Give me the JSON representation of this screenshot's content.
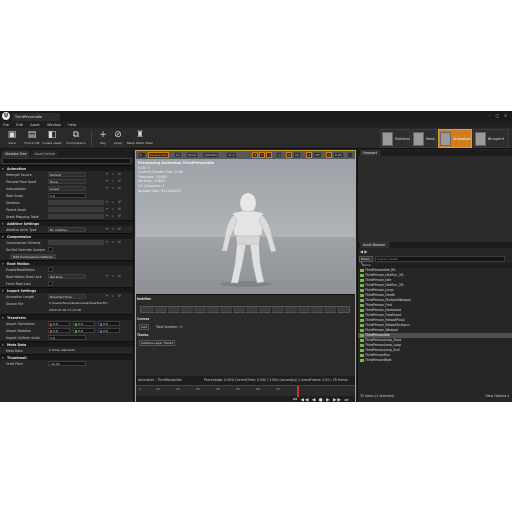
{
  "window": {
    "tab_title": "ThirdPersonIdle",
    "app_logo": "U"
  },
  "menu": [
    "File",
    "Edit",
    "Asset",
    "Window",
    "Help"
  ],
  "toolbar": {
    "buttons": [
      {
        "label": "Save",
        "icon": "save-icon"
      },
      {
        "label": "Find in CB",
        "icon": "find-in-cb-icon"
      },
      {
        "label": "Create Asset",
        "icon": "create-asset-icon"
      },
      {
        "label": "Compression",
        "icon": "compression-icon"
      },
      {
        "label": "Key",
        "icon": "key-icon"
      },
      {
        "label": "Apply",
        "icon": "apply-icon"
      },
      {
        "label": "Make Static Mesh",
        "icon": "static-mesh-icon"
      }
    ],
    "modes": [
      {
        "label": "Skeleton",
        "active": false
      },
      {
        "label": "Mesh",
        "active": false
      },
      {
        "label": "Animation",
        "active": true
      },
      {
        "label": "Blueprint",
        "active": false
      }
    ]
  },
  "left_panel": {
    "tabs": [
      "Skeleton Tree",
      "Asset Details"
    ],
    "sections": [
      {
        "title": "Animation",
        "rows": [
          {
            "key": "Retarget Source",
            "value": "Default",
            "type": "dd"
          },
          {
            "key": "Preview Pose Asset",
            "value": "None",
            "type": "dd"
          },
          {
            "key": "Interpolation",
            "value": "Linear",
            "type": "dd"
          },
          {
            "key": "Rate Scale",
            "value": "1.0",
            "type": "num"
          },
          {
            "key": "Skeleton",
            "value": "",
            "type": "wide"
          },
          {
            "key": "Parent Asset",
            "value": "",
            "type": "wide"
          },
          {
            "key": "Asset Mapping Table",
            "value": "",
            "type": "wide"
          }
        ]
      },
      {
        "title": "Additive Settings",
        "rows": [
          {
            "key": "Additive Anim Type",
            "value": "No additive",
            "type": "dd"
          }
        ]
      },
      {
        "title": "Compression",
        "rows": [
          {
            "key": "Compression Scheme",
            "value": "",
            "type": "wide"
          },
          {
            "key": "Do Not Override Compre",
            "value": "",
            "type": "cb"
          },
          {
            "key": "",
            "value": "Edit Compression Settings",
            "type": "btn"
          }
        ]
      },
      {
        "title": "Root Motion",
        "rows": [
          {
            "key": "EnableRootMotion",
            "value": "",
            "type": "cb"
          },
          {
            "key": "Root Motion Root Lock",
            "value": "Ref Pose",
            "type": "dd"
          },
          {
            "key": "Force Root Lock",
            "value": "",
            "type": "cb"
          }
        ]
      },
      {
        "title": "Import Settings",
        "rows": [
          {
            "key": "Animation Length",
            "value": "Exported Time",
            "type": "dd"
          },
          {
            "key": "Source File",
            "value": "C:/Users/Tarun/Downloads/Desktop/TP...",
            "type": "text2"
          },
          {
            "key": "",
            "value": "2019-07-30 17:13:46",
            "type": "plain"
          }
        ]
      },
      {
        "title": "Transform",
        "rows": [
          {
            "key": "Import Translation",
            "vec": [
              "0.0",
              "0.0",
              "0.0"
            ]
          },
          {
            "key": "Import Rotation",
            "vec": [
              "0.0",
              "0.0",
              "0.0"
            ]
          },
          {
            "key": "Import Uniform Scale",
            "value": "1.0",
            "type": "num"
          }
        ]
      },
      {
        "title": "Meta Data",
        "rows": [
          {
            "key": "Meta Data",
            "value": "0 Array elements",
            "type": "plain"
          }
        ]
      },
      {
        "title": "Thumbnail",
        "rows": [
          {
            "key": "Orbit Pitch",
            "value": "-11.25",
            "type": "num"
          }
        ]
      }
    ]
  },
  "viewport": {
    "toolbar": [
      "",
      "Perspective",
      "Lit",
      "Show",
      "100.00%",
      "x1.0"
    ],
    "overlay": [
      "Previewing Animation ThirdPersonIdle",
      "LOD: 0",
      "Current Screen Size: 0.66",
      "Triangles: 31082",
      "Vertices: 23697",
      "UV Channels: 1",
      "Approx Size: 91x182x33"
    ],
    "toolbar_right": [
      "10",
      "10°",
      "0.25"
    ]
  },
  "anim_panel": {
    "notifies_label": "Notifies",
    "curves_label": "Curves",
    "curves_button": "Add",
    "curves_total": "Total Number : 0",
    "tracks_label": "Tracks",
    "tracks_button": "Additive Layer Tracks",
    "status_left": "Animation : ThirdPersonIdle",
    "status_right": "Percentage: 0.00%  CurrentTime: 0.000 / 2.000 (second(s))  CurrentFrame: 0.00 / 78 Frame",
    "ticks": [
      "0",
      "10",
      "20",
      "30",
      "40",
      "50",
      "60",
      "70"
    ],
    "transport": "⏮ ◀◀ ◀ ● ▶ ▶▶ ⏭ ⟳"
  },
  "right_top": {
    "tabs": [
      "Viewport"
    ]
  },
  "asset_browser": {
    "tab": "Asset Browser",
    "filter_label": "Filters ▾",
    "search_placeholder": "Search Assets",
    "column": "Name",
    "items": [
      {
        "name": "ThirdPersonIdle_BS",
        "selected": false
      },
      {
        "name": "ThirdPerson_IdleRun_2D",
        "selected": false
      },
      {
        "name": "ThirdPerson_Idle",
        "selected": false
      },
      {
        "name": "ThirdPerson_IdleRun_2D",
        "selected": false
      },
      {
        "name": "ThirdPerson_Jump",
        "selected": false
      },
      {
        "name": "ThirdPerson_Death",
        "selected": false
      },
      {
        "name": "ThirdPerson_MultipleWeapon",
        "selected": false
      },
      {
        "name": "ThirdPerson_Fwd",
        "selected": false
      },
      {
        "name": "ThirdPerson_Backward",
        "selected": false
      },
      {
        "name": "ThirdPerson_FwdShoot",
        "selected": false
      },
      {
        "name": "ThirdPerson_ReloadPistol",
        "selected": false
      },
      {
        "name": "ThirdPerson_ReloadShotgun",
        "selected": false
      },
      {
        "name": "ThirdPerson_Weapon",
        "selected": false
      },
      {
        "name": "ThirdPersonIdle",
        "selected": true
      },
      {
        "name": "ThirdPersonJump_Start",
        "selected": false
      },
      {
        "name": "ThirdPersonJump_Loop",
        "selected": false
      },
      {
        "name": "ThirdPersonJump_End",
        "selected": false
      },
      {
        "name": "ThirdPersonRun",
        "selected": false
      },
      {
        "name": "ThirdPersonWalk",
        "selected": false
      }
    ],
    "status": "33 items (1 selected)",
    "view_options": "View Options ▾"
  }
}
